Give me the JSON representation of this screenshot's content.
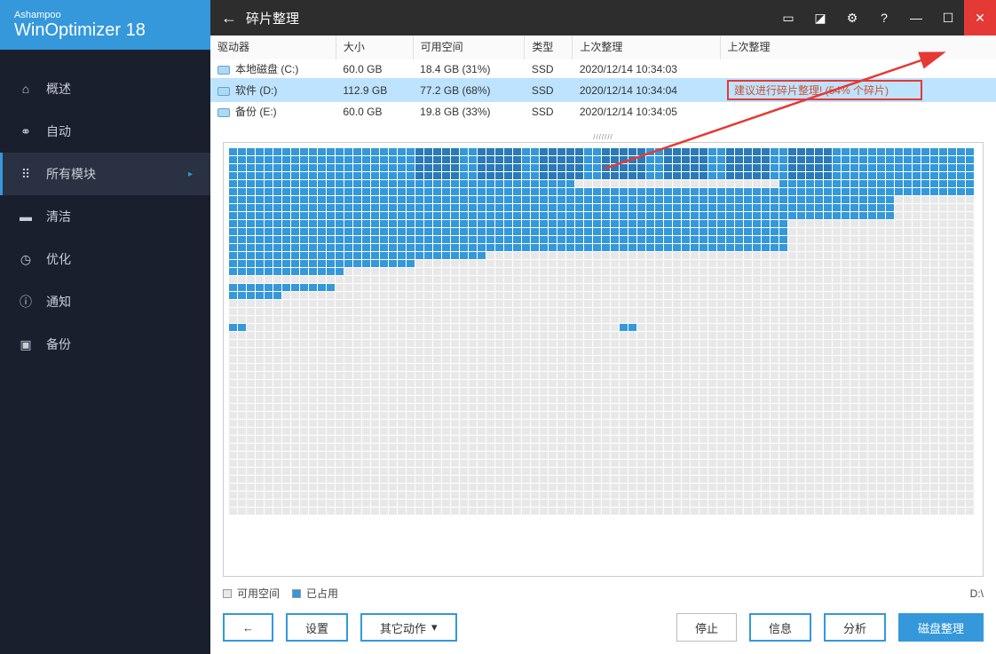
{
  "app": {
    "brand_small": "Ashampoo",
    "brand_main": "WinOptimizer 18"
  },
  "titlebar": {
    "title": "碎片整理"
  },
  "nav": {
    "items": [
      {
        "label": "概述",
        "icon": "home-icon"
      },
      {
        "label": "自动",
        "icon": "auto-icon"
      },
      {
        "label": "所有模块",
        "icon": "modules-icon",
        "active": true,
        "expandable": true
      },
      {
        "label": "清洁",
        "icon": "clean-icon"
      },
      {
        "label": "优化",
        "icon": "optimize-icon"
      },
      {
        "label": "通知",
        "icon": "notify-icon"
      },
      {
        "label": "备份",
        "icon": "backup-icon"
      }
    ]
  },
  "table": {
    "headers": {
      "drive": "驱动器",
      "size": "大小",
      "free": "可用空间",
      "type": "类型",
      "last1": "上次整理",
      "last2": "上次整理"
    },
    "rows": [
      {
        "name": "本地磁盘 (C:)",
        "size": "60.0 GB",
        "free": "18.4 GB (31%)",
        "type": "SSD",
        "last": "2020/12/14 10:34:03",
        "note": ""
      },
      {
        "name": "软件 (D:)",
        "size": "112.9 GB",
        "free": "77.2 GB (68%)",
        "type": "SSD",
        "last": "2020/12/14 10:34:04",
        "note": "建议进行碎片整理! (54% 个碎片)",
        "selected": true,
        "highlight": true
      },
      {
        "name": "备份 (E:)",
        "size": "60.0 GB",
        "free": "19.8 GB (33%)",
        "type": "SSD",
        "last": "2020/12/14 10:34:05",
        "note": ""
      }
    ]
  },
  "legend": {
    "free": "可用空间",
    "used": "已占用",
    "drive": "D:\\"
  },
  "buttons": {
    "back": "←",
    "settings": "设置",
    "other": "其它动作",
    "stop": "停止",
    "info": "信息",
    "analyze": "分析",
    "defrag": "磁盘整理"
  },
  "colors": {
    "accent": "#3498db",
    "danger": "#e53935",
    "sidebar": "#1a1f2e"
  }
}
